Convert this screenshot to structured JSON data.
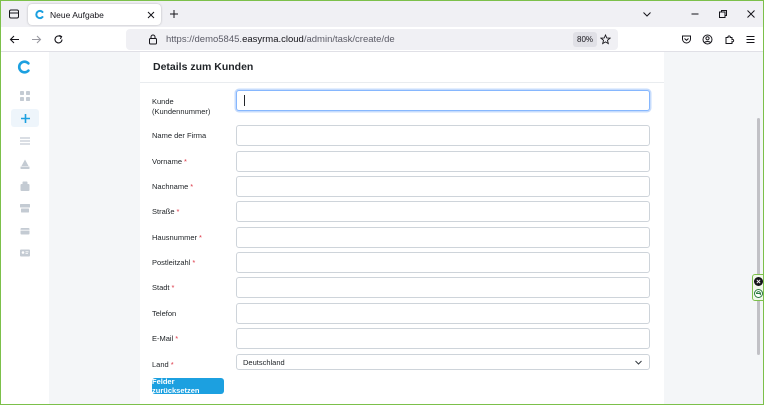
{
  "browser": {
    "tab": {
      "title": "Neue Aufgabe"
    },
    "url": {
      "prefix": "https://demo5845.",
      "domain": "easyrma.cloud",
      "path": "/admin/task/create/de"
    },
    "zoom": "80%"
  },
  "colors": {
    "accent": "#1ca0e0",
    "required": "#dc3545",
    "window_border": "#7cc04a"
  },
  "sidebar": {
    "items": [
      {
        "icon": "dashboard-icon"
      },
      {
        "icon": "plus-icon"
      },
      {
        "icon": "list-icon"
      },
      {
        "icon": "user-icon"
      },
      {
        "icon": "inbox-icon"
      },
      {
        "icon": "box-icon"
      },
      {
        "icon": "card-icon"
      },
      {
        "icon": "id-card-icon"
      }
    ]
  },
  "form": {
    "title": "Details zum Kunden",
    "fields": [
      {
        "label": "Kunde (Kundennummer)",
        "label_line1": "Kunde",
        "label_line2": "(Kundennummer)",
        "value": "",
        "required": false
      },
      {
        "label": "Name der Firma",
        "value": "",
        "required": false
      },
      {
        "label": "Vorname",
        "value": "",
        "required": true
      },
      {
        "label": "Nachname",
        "value": "",
        "required": true
      },
      {
        "label": "Straße",
        "value": "",
        "required": true
      },
      {
        "label": "Hausnummer",
        "value": "",
        "required": true
      },
      {
        "label": "Postleitzahl",
        "value": "",
        "required": true
      },
      {
        "label": "Stadt",
        "value": "",
        "required": true
      },
      {
        "label": "Telefon",
        "value": "",
        "required": false
      },
      {
        "label": "E-Mail",
        "value": "",
        "required": true
      },
      {
        "label": "Land",
        "value": "Deutschland",
        "required": true
      }
    ],
    "required_mark": "*",
    "reset_label": "Felder zurücksetzen"
  }
}
